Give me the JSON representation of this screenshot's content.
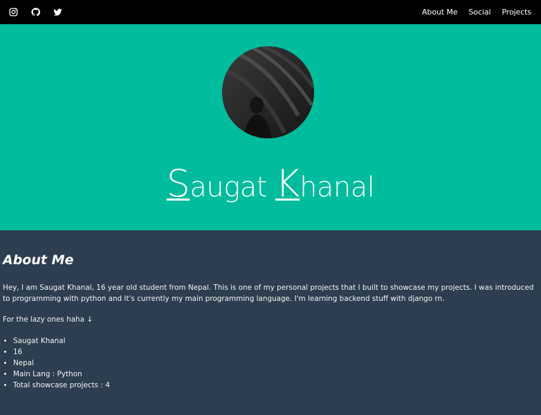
{
  "nav": {
    "icons": [
      "instagram-icon",
      "github-icon",
      "twitter-icon"
    ],
    "links": [
      "About Me",
      "Social",
      "Projects"
    ]
  },
  "hero": {
    "name_first_initial": "S",
    "name_first_rest": "augat",
    "name_last_initial": "K",
    "name_last_rest": "hanal"
  },
  "about": {
    "heading": "About Me",
    "intro": "Hey, I am Saugat Khanal, 16 year old student from Nepal. This is one of my personal projects that I built to showcase my projects. I was introduced to programming with python and It's currently my main programming language. I'm learning backend stuff with django rn.",
    "lazy_line": "For the lazy ones haha ↓",
    "facts": [
      "Saugat Khanal",
      "16",
      "Nepal",
      "Main Lang : Python",
      "Total showcase projects : 4"
    ]
  },
  "colors": {
    "nav_bg": "#000000",
    "hero_bg": "#00bc9c",
    "body_bg": "#2c3e50",
    "text": "#ffffff"
  }
}
